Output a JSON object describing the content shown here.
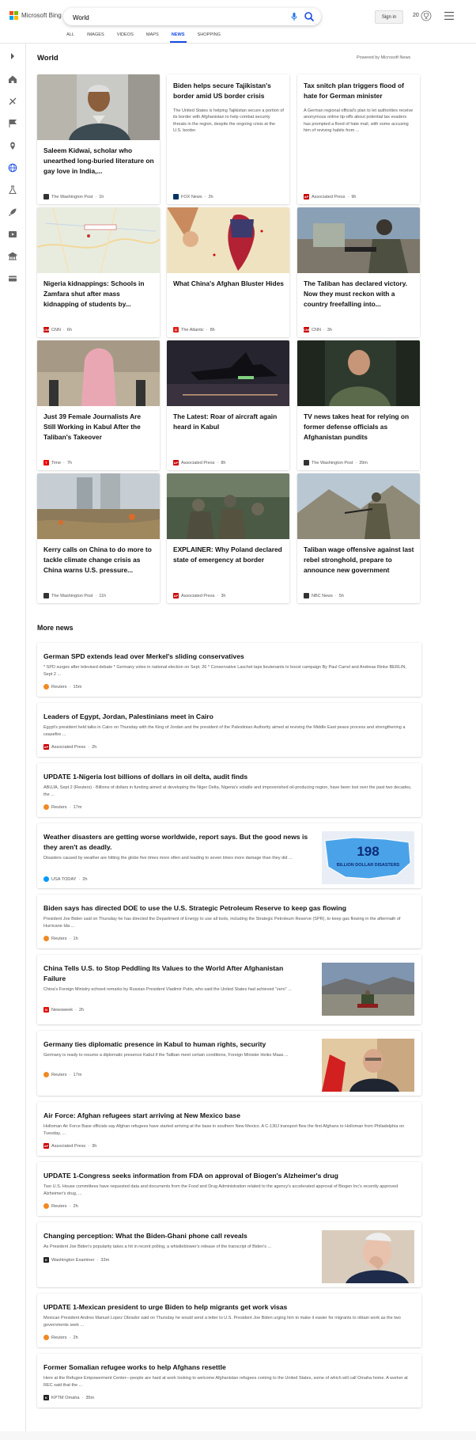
{
  "header": {
    "brand": "Microsoft Bing",
    "search_value": "World",
    "signin": "Sign in",
    "rewards_count": "20",
    "tabs": [
      "ALL",
      "IMAGES",
      "VIDEOS",
      "MAPS",
      "NEWS",
      "SHOPPING"
    ],
    "active_tab": "NEWS"
  },
  "world": {
    "title": "World",
    "powered": "Powered by Microsoft News",
    "cards": [
      {
        "title": "Saleem Kidwai, scholar who unearthed long-buried literature on gay love in India,...",
        "source": "The Washington Post",
        "time": "1h",
        "logo_color": "#333"
      },
      {
        "title": "Biden helps secure Tajikistan's border amid US border crisis",
        "summary": "The United States is helping Tajikistan secure a portion of its border with Afghanistan to help combat security threats in the region, despite the ongoing crisis at the U.S. border.",
        "source": "FOX News",
        "time": "2h",
        "logo_color": "#003366"
      },
      {
        "title": "Tax snitch plan triggers flood of hate for German minister",
        "summary": "A German regional official's plan to let authorities receive anonymous online tip-offs about potential tax evaders has prompted a flood of hate mail, with some accusing him of reviving habits from ...",
        "source": "Associated Press",
        "time": "9h",
        "logo_color": "#c00"
      },
      {
        "title": "Nigeria kidnappings: Schools in Zamfara shut after mass kidnapping of students by...",
        "source": "CNN",
        "time": "6h",
        "logo_color": "#cc0000"
      },
      {
        "title": "What China's Afghan Bluster Hides",
        "source": "The Atlantic",
        "time": "8h",
        "logo_color": "#e0201c"
      },
      {
        "title": "The Taliban has declared victory. Now they must reckon with a country freefalling into...",
        "source": "CNN",
        "time": "3h",
        "logo_color": "#cc0000"
      },
      {
        "title": "Just 39 Female Journalists Are Still Working in Kabul After the Taliban's Takeover",
        "source": "Time",
        "time": "7h",
        "logo_color": "#e00"
      },
      {
        "title": "The Latest: Roar of aircraft again heard in Kabul",
        "source": "Associated Press",
        "time": "8h",
        "logo_color": "#c00"
      },
      {
        "title": "TV news takes heat for relying on former defense officials as Afghanistan pundits",
        "source": "The Washington Post",
        "time": "39m",
        "logo_color": "#333"
      },
      {
        "title": "Kerry calls on China to do more to tackle climate change crisis as China warns U.S. pressure...",
        "source": "The Washington Post",
        "time": "11h",
        "logo_color": "#333"
      },
      {
        "title": "EXPLAINER: Why Poland declared state of emergency at border",
        "source": "Associated Press",
        "time": "3h",
        "logo_color": "#c00"
      },
      {
        "title": "Taliban wage offensive against last rebel stronghold, prepare to announce new government",
        "source": "NBC News",
        "time": "5h",
        "logo_color": "#333"
      }
    ]
  },
  "more": {
    "title": "More news",
    "items": [
      {
        "title": "German SPD extends lead over Merkel's sliding conservatives",
        "summary": "* SPD surges after televised debate * Germany votes in national election on Sept. 26 * Conservative Laschet taps lieutenants to boost campaign By Paul Carrel and Andreas Rinke BERLIN, Sept 2 ...",
        "source": "Reuters",
        "time": "15m",
        "logo_color": "#f08a24"
      },
      {
        "title": "Leaders of Egypt, Jordan, Palestinians meet in Cairo",
        "summary": "Egypt's president held talks in Cairo on Thursday with the King of Jordan and the president of the Palestinian Authority aimed at reviving the Middle East peace process and strengthening a ceasefire ...",
        "source": "Associated Press",
        "time": "2h",
        "logo_color": "#c00"
      },
      {
        "title": "UPDATE 1-Nigeria lost billions of dollars in oil delta, audit finds",
        "summary": "ABUJA, Sept 2 (Reuters) - Billions of dollars in funding aimed at developing the Niger Delta, Nigeria's volatile and impoverished oil-producing region, have been lost over the past two decades, the ...",
        "source": "Reuters",
        "time": "17m",
        "logo_color": "#f08a24"
      },
      {
        "title": "Weather disasters are getting worse worldwide, report says. But the good news is they aren't as deadly.",
        "summary": "Disasters caused by weather are hitting the globe five times more often and leading to seven times more damage than they did ...",
        "source": "USA TODAY",
        "time": "2h",
        "logo_color": "#009bff",
        "thumb_number": "198",
        "thumb_caption": "BILLION DOLLAR DISASTERS"
      },
      {
        "title": "Biden says has directed DOE to use the U.S. Strategic Petroleum Reserve to keep gas flowing",
        "summary": "President Joe Biden said on Thursday he has directed the Department of Energy to use all tools, including the Strategic Petroleum Reserve (SPR), to keep gas flowing in the aftermath of Hurricane Ida ...",
        "source": "Reuters",
        "time": "1h",
        "logo_color": "#f08a24"
      },
      {
        "title": "China Tells U.S. to Stop Peddling Its Values to the World After Afghanistan Failure",
        "summary": "China's Foreign Ministry echoed remarks by Russian President Vladimir Putin, who said the United States had achieved \"zero\" ...",
        "source": "Newsweek",
        "time": "2h",
        "logo_color": "#e3120b"
      },
      {
        "title": "Germany ties diplomatic presence in Kabul to human rights, security",
        "summary": "Germany is ready to resume a diplomatic presence Kabul if the Taliban meet certain conditions, Foreign Minister Heiko Maas ...",
        "source": "Reuters",
        "time": "17m",
        "logo_color": "#f08a24"
      },
      {
        "title": "Air Force: Afghan refugees start arriving at New Mexico base",
        "summary": "Holloman Air Force Base officials say Afghan refugees have started arriving at the base in southern New Mexico. A C-130J transport flew the first Afghans to Holloman from Philadelphia on Tuesday, ...",
        "source": "Associated Press",
        "time": "3h",
        "logo_color": "#c00"
      },
      {
        "title": "UPDATE 1-Congress seeks information from FDA on approval of Biogen's Alzheimer's drug",
        "summary": "Two U.S. House committees have requested data and documents from the Food and Drug Administration related to the agency's accelerated approval of Biogen Inc's recently approved Alzheimer's drug, ...",
        "source": "Reuters",
        "time": "2h",
        "logo_color": "#f08a24"
      },
      {
        "title": "Changing perception: What the Biden-Ghani phone call reveals",
        "summary": "As President Joe Biden's popularity takes a hit in recent polling, a whistleblower's release of the transcript of Biden's ...",
        "source": "Washington Examiner",
        "time": "33m",
        "logo_color": "#222"
      },
      {
        "title": "UPDATE 1-Mexican president to urge Biden to help migrants get work visas",
        "summary": "Mexican President Andres Manuel Lopez Obrador said on Thursday he would send a letter to U.S. President Joe Biden urging him to make it easier for migrants to obtain work as the two governments seek ...",
        "source": "Reuters",
        "time": "2h",
        "logo_color": "#f08a24"
      },
      {
        "title": "Former Somalian refugee works to help Afghans resettle",
        "summary": "Here at the Refugee Empowerment Center—people are hard at work looking to welcome Afghanistan refugees coming to the United States, some of which will call Omaha home. A worker at REC said that the ...",
        "source": "KPTM Omaha",
        "time": "35m",
        "logo_color": "#222"
      }
    ]
  }
}
